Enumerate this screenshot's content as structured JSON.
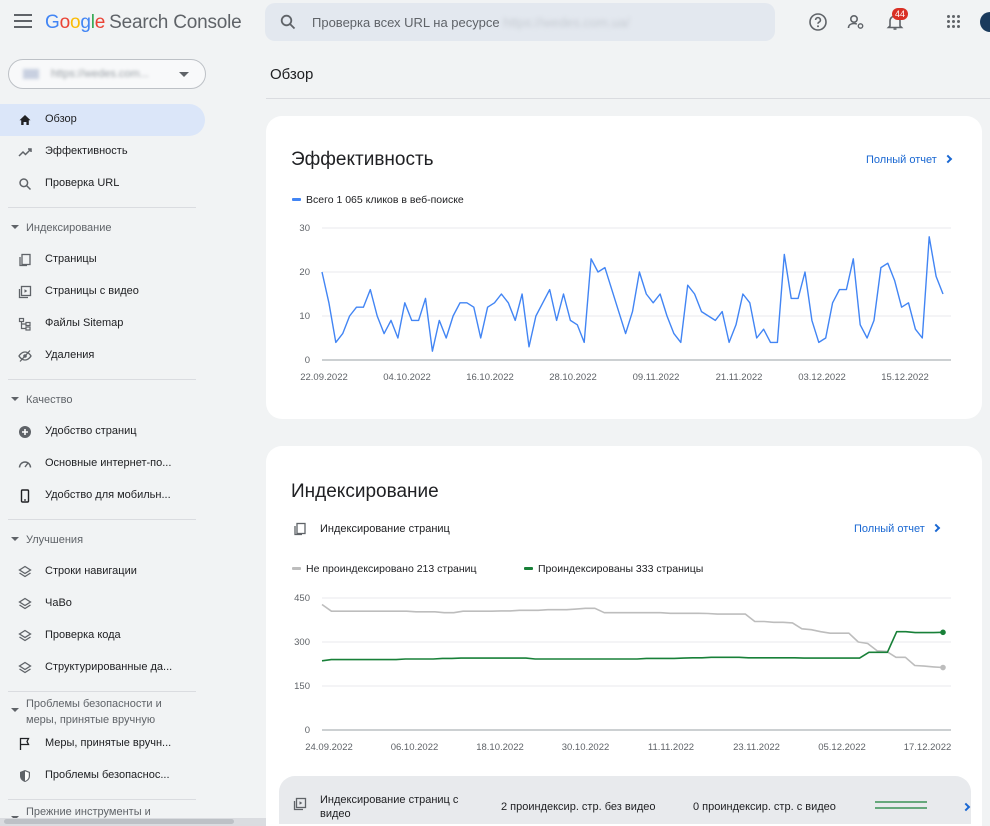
{
  "app": {
    "logo_google": [
      "G",
      "o",
      "o",
      "g",
      "l",
      "e"
    ],
    "logo_product": "Search Console",
    "search_placeholder": "Проверка всех URL на ресурсе",
    "search_domain": "https://wedes.com.ua/",
    "notifications_count": "44"
  },
  "sidebar": {
    "property": "https://wedes.com...",
    "top_items": [
      {
        "label": "Обзор",
        "icon": "home-icon"
      },
      {
        "label": "Эффективность",
        "icon": "trending-up-icon"
      },
      {
        "label": "Проверка URL",
        "icon": "search-icon"
      }
    ],
    "sections": [
      {
        "title": "Индексирование",
        "items": [
          {
            "label": "Страницы",
            "icon": "pages-icon"
          },
          {
            "label": "Страницы с видео",
            "icon": "video-pages-icon"
          },
          {
            "label": "Файлы Sitemap",
            "icon": "sitemap-icon"
          },
          {
            "label": "Удаления",
            "icon": "removals-icon"
          }
        ]
      },
      {
        "title": "Качество",
        "items": [
          {
            "label": "Удобство страниц",
            "icon": "plus-circle-icon"
          },
          {
            "label": "Основные интернет-по...",
            "icon": "gauge-icon"
          },
          {
            "label": "Удобство для мобильн...",
            "icon": "phone-icon"
          }
        ]
      },
      {
        "title": "Улучшения",
        "items": [
          {
            "label": "Строки навигации",
            "icon": "layers-icon"
          },
          {
            "label": "ЧаВо",
            "icon": "layers-icon"
          },
          {
            "label": "Проверка кода",
            "icon": "layers-icon"
          },
          {
            "label": "Структурированные да...",
            "icon": "layers-icon"
          }
        ]
      },
      {
        "title": "Проблемы безопасности и меры, принятые вручную",
        "items": [
          {
            "label": "Меры, принятые вручн...",
            "icon": "flag-icon"
          },
          {
            "label": "Проблемы безопаснос...",
            "icon": "shield-icon"
          }
        ]
      },
      {
        "title": "Прежние инструменты и",
        "items": []
      }
    ]
  },
  "main": {
    "page_title": "Обзор",
    "performance": {
      "title": "Эффективность",
      "full_report": "Полный отчет",
      "legend": "Всего 1 065 кликов в веб-поиске"
    },
    "indexing": {
      "title": "Индексирование",
      "pages_label": "Индексирование страниц",
      "full_report": "Полный отчет",
      "legend_not_indexed": "Не проиндексировано 213 страниц",
      "legend_indexed": "Проиндексированы 333 страницы",
      "video_row": {
        "label": "Индексирование страниц с видео",
        "without_video": "2 проиндексир. стр. без видео",
        "with_video": "0 проиндексир. стр. с видео"
      }
    }
  },
  "colors": {
    "accent": "#1967d2",
    "clicks": "#4285f4",
    "not_indexed": "#bdbdbd",
    "indexed": "#188038"
  },
  "chart_data": [
    {
      "type": "line",
      "ylim": [
        0,
        30
      ],
      "yticks": [
        0,
        10,
        20,
        30
      ],
      "xticks": [
        "22.09.2022",
        "04.10.2022",
        "16.10.2022",
        "28.10.2022",
        "09.11.2022",
        "21.11.2022",
        "03.12.2022",
        "15.12.2022"
      ],
      "series": [
        {
          "values": [
            20,
            13,
            4,
            6,
            10,
            12,
            12,
            16,
            10,
            6,
            9,
            5,
            13,
            9,
            9,
            14,
            2,
            9,
            5,
            10,
            13,
            13,
            12,
            5,
            12,
            13,
            15,
            13,
            9,
            15,
            3,
            10,
            13,
            16,
            9,
            15,
            9,
            8,
            4,
            23,
            20,
            21,
            16,
            11,
            6,
            11,
            20,
            15,
            13,
            15,
            10,
            6,
            4,
            17,
            15,
            11,
            10,
            9,
            11,
            4,
            8,
            15,
            13,
            5,
            7,
            4,
            4,
            24,
            14,
            14,
            20,
            9,
            4,
            5,
            13,
            16,
            16,
            23,
            8,
            5,
            9,
            21,
            22,
            18,
            12,
            13,
            7,
            5,
            28,
            19,
            15
          ]
        }
      ]
    },
    {
      "type": "line",
      "ylim": [
        0,
        450
      ],
      "yticks": [
        0,
        150,
        300,
        450
      ],
      "xticks": [
        "24.09.2022",
        "06.10.2022",
        "18.10.2022",
        "30.10.2022",
        "11.11.2022",
        "23.11.2022",
        "05.12.2022",
        "17.12.2022"
      ],
      "series": [
        {
          "name": "Не проиндексировано 213 страниц",
          "values": [
            428,
            405,
            405,
            405,
            405,
            405,
            405,
            405,
            405,
            405,
            403,
            403,
            403,
            400,
            400,
            405,
            405,
            405,
            405,
            406,
            406,
            408,
            408,
            408,
            410,
            410,
            410,
            412,
            415,
            415,
            400,
            400,
            400,
            400,
            400,
            400,
            400,
            398,
            398,
            398,
            398,
            397,
            395,
            395,
            395,
            395,
            370,
            370,
            367,
            367,
            365,
            345,
            342,
            335,
            330,
            330,
            330,
            300,
            295,
            270,
            268,
            248,
            248,
            220,
            218,
            215,
            213
          ]
        },
        {
          "name": "Проиндексированы 333 страницы",
          "values": [
            236,
            240,
            240,
            240,
            240,
            240,
            240,
            240,
            240,
            242,
            242,
            242,
            242,
            244,
            244,
            245,
            245,
            245,
            245,
            245,
            245,
            245,
            245,
            242,
            242,
            242,
            242,
            242,
            242,
            242,
            242,
            242,
            242,
            242,
            242,
            244,
            244,
            244,
            244,
            245,
            246,
            246,
            248,
            248,
            248,
            248,
            246,
            246,
            246,
            246,
            246,
            246,
            245,
            245,
            245,
            245,
            245,
            245,
            245,
            265,
            265,
            265,
            335,
            335,
            332,
            332,
            332,
            333
          ]
        }
      ]
    }
  ]
}
